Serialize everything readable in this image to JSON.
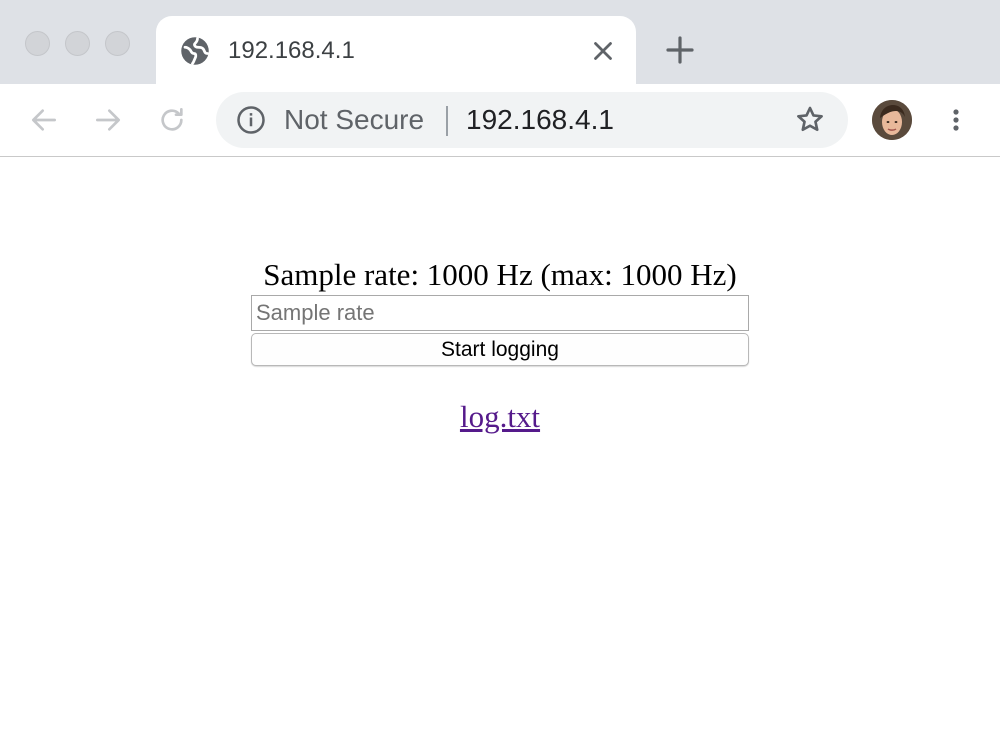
{
  "browser": {
    "tab": {
      "title": "192.168.4.1",
      "icon": "globe-icon"
    },
    "omnibox": {
      "security_text": "Not Secure",
      "url": "192.168.4.1",
      "info_icon": "info-icon",
      "star_icon": "star-icon"
    },
    "colors": {
      "tabstrip": "#dee1e6",
      "omnibox": "#f1f3f4"
    }
  },
  "page": {
    "sample_rate_text": "Sample rate: 1000 Hz (max: 1000 Hz)",
    "sample_rate_input": {
      "value": "",
      "placeholder": "Sample rate"
    },
    "start_button_label": "Start logging",
    "log_link_text": "log.txt",
    "colors": {
      "visited_link": "#551a8b"
    }
  }
}
